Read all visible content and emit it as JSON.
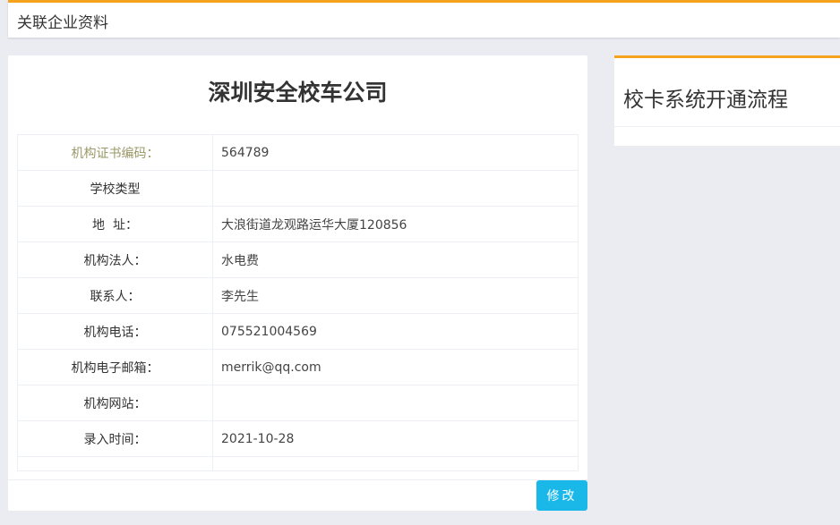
{
  "header": {
    "title": "关联企业资料"
  },
  "company": {
    "name": "深圳安全校车公司"
  },
  "info_rows": [
    {
      "label": "机构证书编码：",
      "value": "564789",
      "highlight": true
    },
    {
      "label": "学校类型",
      "value": ""
    },
    {
      "label": "地  址：",
      "value": "大浪街道龙观路运华大厦120856"
    },
    {
      "label": "机构法人：",
      "value": "水电费"
    },
    {
      "label": "联系人：",
      "value": "李先生"
    },
    {
      "label": "机构电话：",
      "value": "075521004569"
    },
    {
      "label": "机构电子邮箱：",
      "value": "merrik@qq.com"
    },
    {
      "label": "机构网站：",
      "value": ""
    },
    {
      "label": "录入时间：",
      "value": "2021-10-28"
    }
  ],
  "actions": {
    "edit_label": "修改"
  },
  "side_panel": {
    "title": "校卡系统开通流程"
  },
  "colors": {
    "accent": "#f5a21c",
    "button": "#1ab8e9",
    "highlight_label": "#9b9867"
  }
}
